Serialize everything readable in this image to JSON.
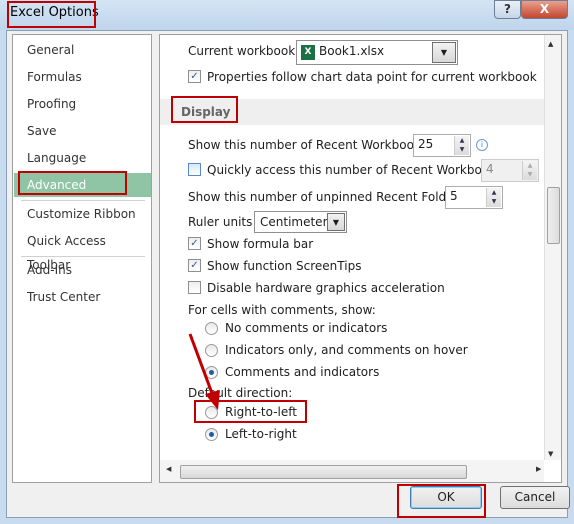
{
  "window": {
    "title": "Excel Options",
    "help_label": "?",
    "close_label": "X"
  },
  "nav": {
    "items": [
      {
        "label": "General"
      },
      {
        "label": "Formulas"
      },
      {
        "label": "Proofing"
      },
      {
        "label": "Save"
      },
      {
        "label": "Language"
      },
      {
        "label": "Advanced",
        "selected": true
      },
      {
        "label": "Customize Ribbon"
      },
      {
        "label": "Quick Access Toolbar"
      },
      {
        "label": "Add-Ins"
      },
      {
        "label": "Trust Center"
      }
    ]
  },
  "content": {
    "current_workbook_label": "Current workbook:",
    "current_workbook_value": "Book1.xlsx",
    "properties_follow": {
      "label": "Properties follow chart data point for current workbook",
      "checked": true
    },
    "section_title": "Display",
    "recent_workbooks": {
      "label": "Show this number of Recent Workbooks:",
      "value": "25"
    },
    "quick_access": {
      "label": "Quickly access this number of Recent Workbooks:",
      "value": "4",
      "checked": false
    },
    "recent_folders": {
      "label": "Show this number of unpinned Recent Folders:",
      "value": "5"
    },
    "ruler_units": {
      "label": "Ruler units",
      "value": "Centimeters"
    },
    "show_formula_bar": {
      "label": "Show formula bar",
      "checked": true
    },
    "show_screentips": {
      "label": "Show function ScreenTips",
      "checked": true
    },
    "disable_hw": {
      "label": "Disable hardware graphics acceleration",
      "checked": false
    },
    "comments_label": "For cells with comments, show:",
    "comments_options": [
      {
        "label": "No comments or indicators",
        "selected": false
      },
      {
        "label": "Indicators only, and comments on hover",
        "selected": false
      },
      {
        "label": "Comments and indicators",
        "selected": true
      }
    ],
    "direction_label": "Default direction:",
    "direction_options": [
      {
        "label": "Right-to-left",
        "selected": false
      },
      {
        "label": "Left-to-right",
        "selected": true
      }
    ]
  },
  "buttons": {
    "ok": "OK",
    "cancel": "Cancel"
  },
  "annotation_color": "#c00000"
}
